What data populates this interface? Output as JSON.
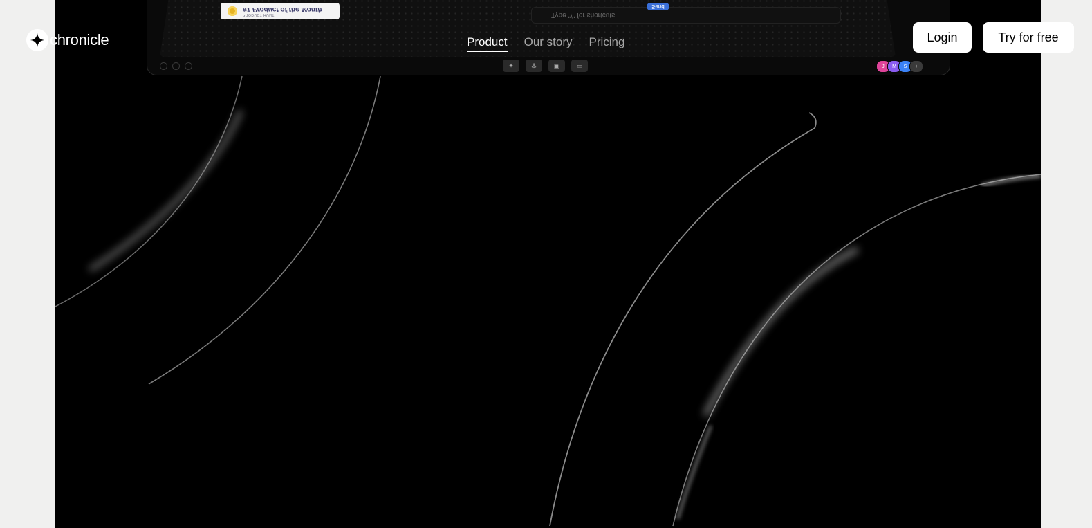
{
  "brand": {
    "name": "chronicle",
    "logo_icon": "sparkle-icon"
  },
  "nav": {
    "items": [
      {
        "label": "Product",
        "active": true
      },
      {
        "label": "Our story",
        "active": false
      },
      {
        "label": "Pricing",
        "active": false
      }
    ]
  },
  "header": {
    "login_label": "Login",
    "cta_label": "Try for free"
  },
  "mockup": {
    "badge_top": "PRODUCT HUNT",
    "badge_title": "#1 Product of the Month",
    "command_placeholder": "Type \"/\" for shortcuts",
    "send_label": "Send",
    "toolbar_icons": [
      "sparkle-icon",
      "anchor-icon",
      "image-icon",
      "card-icon"
    ],
    "avatars": [
      {
        "initial": "J",
        "color": "#e0449a"
      },
      {
        "initial": "M",
        "color": "#8a5cf0"
      },
      {
        "initial": "S",
        "color": "#3b82f6"
      },
      {
        "initial": "+",
        "color": "#3a3a3a"
      }
    ]
  },
  "colors": {
    "page_bg": "#f0f0ef",
    "stage_bg": "#000000",
    "accent": "#ffffff"
  }
}
